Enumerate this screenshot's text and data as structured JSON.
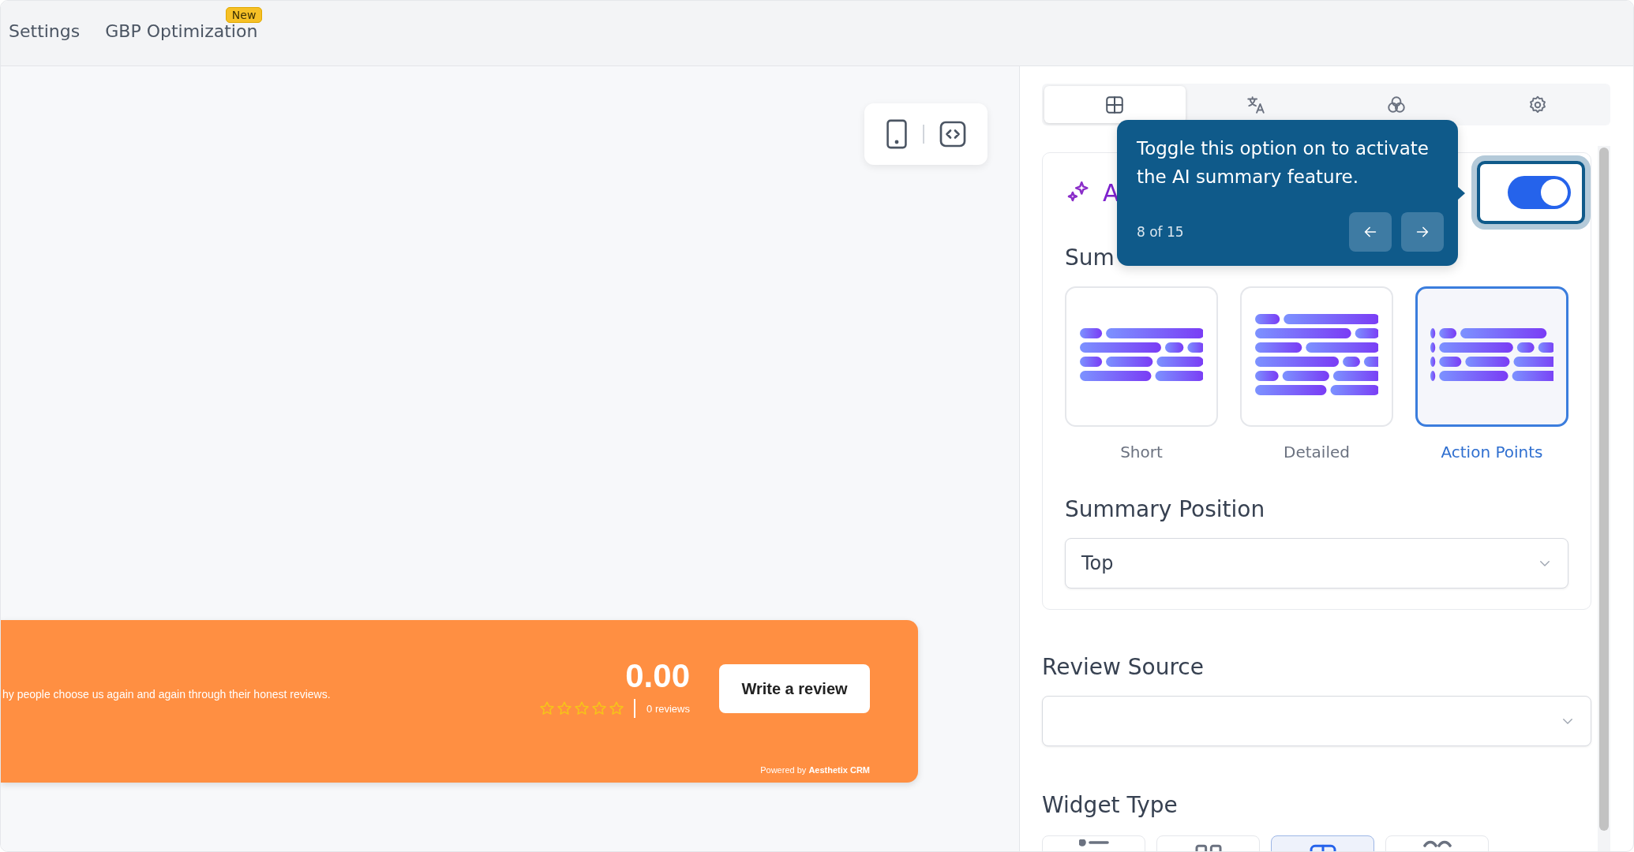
{
  "top_nav": {
    "items": [
      {
        "label": "Settings"
      },
      {
        "label": "GBP Optimization",
        "badge": "New"
      }
    ]
  },
  "review_banner": {
    "text": "hy people choose us again and again through their honest reviews.",
    "rating": "0.00",
    "stars": 0,
    "review_count": "0 reviews",
    "button": "Write a review",
    "powered_by": "Powered by **Aesthetix CRM**"
  },
  "settings_panel": {
    "tabs": [
      {
        "kind": "layout",
        "selected": true
      },
      {
        "kind": "translate",
        "selected": false
      },
      {
        "kind": "colors",
        "selected": false
      },
      {
        "kind": "settings",
        "selected": false
      }
    ],
    "ai_summary": {
      "title": "A",
      "on": true,
      "summary_type_label": "Sum",
      "summary_types": [
        {
          "label": "Short",
          "kind": "short",
          "selected": false
        },
        {
          "label": "Detailed",
          "kind": "detailed",
          "selected": false
        },
        {
          "label": "Action Points",
          "kind": "action_points",
          "selected": true
        }
      ],
      "position_label": "Summary Position",
      "position_value": "Top"
    },
    "review_source": {
      "label": "Review Source"
    },
    "widget_type": {
      "label": "Widget Type",
      "options": [
        {
          "kind": "list",
          "selected": false
        },
        {
          "kind": "grid",
          "selected": false
        },
        {
          "kind": "carousel",
          "selected": true
        },
        {
          "kind": "slider",
          "selected": false
        }
      ]
    }
  },
  "tour_tooltip": {
    "text": "Toggle this option on to activate the AI summary feature.",
    "step": "8 of 15"
  }
}
